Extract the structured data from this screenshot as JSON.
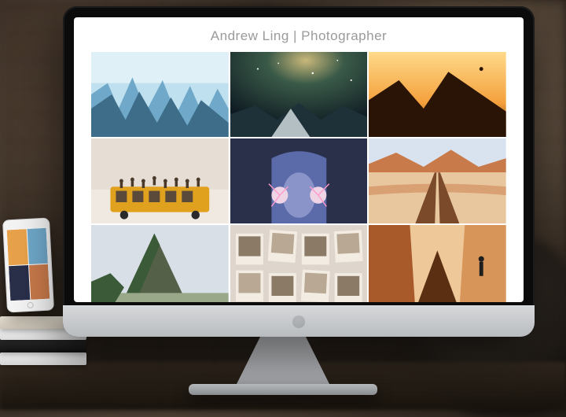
{
  "site": {
    "title": "Andrew Ling | Photographer"
  },
  "gallery": {
    "tiles": [
      {
        "name": "glacier",
        "palette": [
          "#6fa8c9",
          "#bfe0ee",
          "#3d6d88",
          "#eaf4f9"
        ]
      },
      {
        "name": "milky-way",
        "palette": [
          "#0e1a22",
          "#3a5a48",
          "#c9b87a",
          "#1e3038"
        ]
      },
      {
        "name": "sunset-peak",
        "palette": [
          "#f4a03c",
          "#6b3a12",
          "#2a1405",
          "#ffd98a"
        ]
      },
      {
        "name": "bus-crowd",
        "palette": [
          "#d8cfc6",
          "#e0a11e",
          "#5b4a3a",
          "#efe9e1"
        ]
      },
      {
        "name": "sparklers",
        "palette": [
          "#2a2f4a",
          "#d86aa8",
          "#5b6aa8",
          "#efd4e6"
        ]
      },
      {
        "name": "desert-road",
        "palette": [
          "#c97a4a",
          "#e9c79e",
          "#7a4a2a",
          "#d8e3ef"
        ]
      },
      {
        "name": "kirkjufell",
        "palette": [
          "#3a5a38",
          "#9aa88a",
          "#d8dfe6",
          "#556048"
        ]
      },
      {
        "name": "polaroids",
        "palette": [
          "#ded6cc",
          "#b8a894",
          "#8a7a66",
          "#f2ece2"
        ]
      },
      {
        "name": "canyon-figure",
        "palette": [
          "#a85a2a",
          "#d8955a",
          "#5a2f12",
          "#efc89a"
        ]
      }
    ]
  },
  "phone_gallery": {
    "tiles": [
      {
        "name": "p-sunset",
        "color": "#e8a24a"
      },
      {
        "name": "p-sea",
        "color": "#6fa8c9"
      },
      {
        "name": "p-dark",
        "color": "#2a2f4a"
      },
      {
        "name": "p-sand",
        "color": "#c97a4a"
      }
    ]
  }
}
